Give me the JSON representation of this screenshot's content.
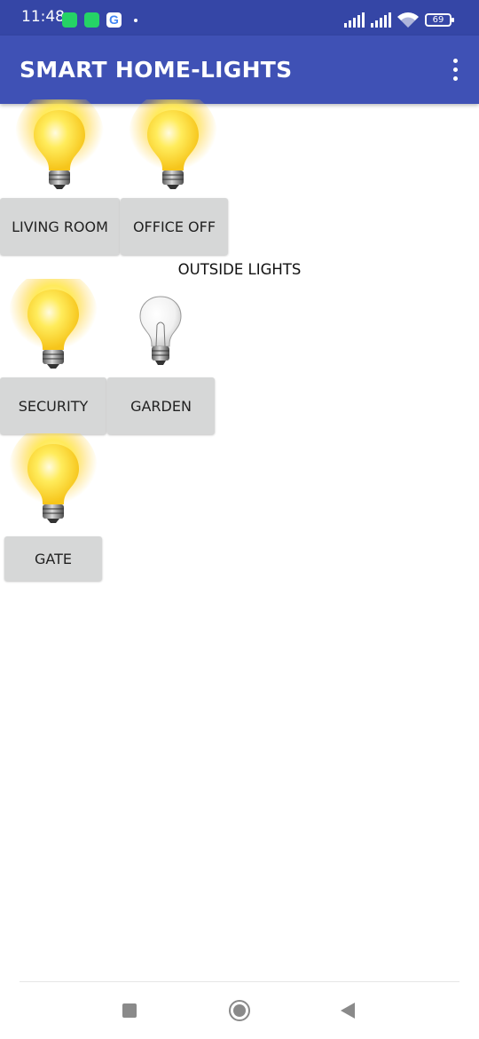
{
  "status_bar": {
    "time": "11:48",
    "notification_icons": [
      "whatsapp-icon",
      "whatsapp-business-icon",
      "google-icon",
      "dot-icon"
    ],
    "battery": "69"
  },
  "app_bar": {
    "title": "SMART HOME-LIGHTS",
    "menu_icon": "more-vertical-icon"
  },
  "indoor_lights": [
    {
      "label": "LIVING ROOM",
      "state": "on"
    },
    {
      "label": "OFFICE OFF",
      "state": "on"
    }
  ],
  "outside_section_label": "OUTSIDE LIGHTS",
  "outside_lights": [
    {
      "label": "SECURITY",
      "state": "on"
    },
    {
      "label": "GARDEN",
      "state": "off"
    },
    {
      "label": "GATE",
      "state": "on"
    }
  ],
  "nav_bar": {
    "icons": [
      "recents-square-icon",
      "home-circle-icon",
      "back-triangle-icon"
    ]
  },
  "colors": {
    "status_bar": "#3546a6",
    "app_bar": "#3f51b5",
    "button": "#d6d7d7",
    "bulb_on": "#ffe84a"
  }
}
